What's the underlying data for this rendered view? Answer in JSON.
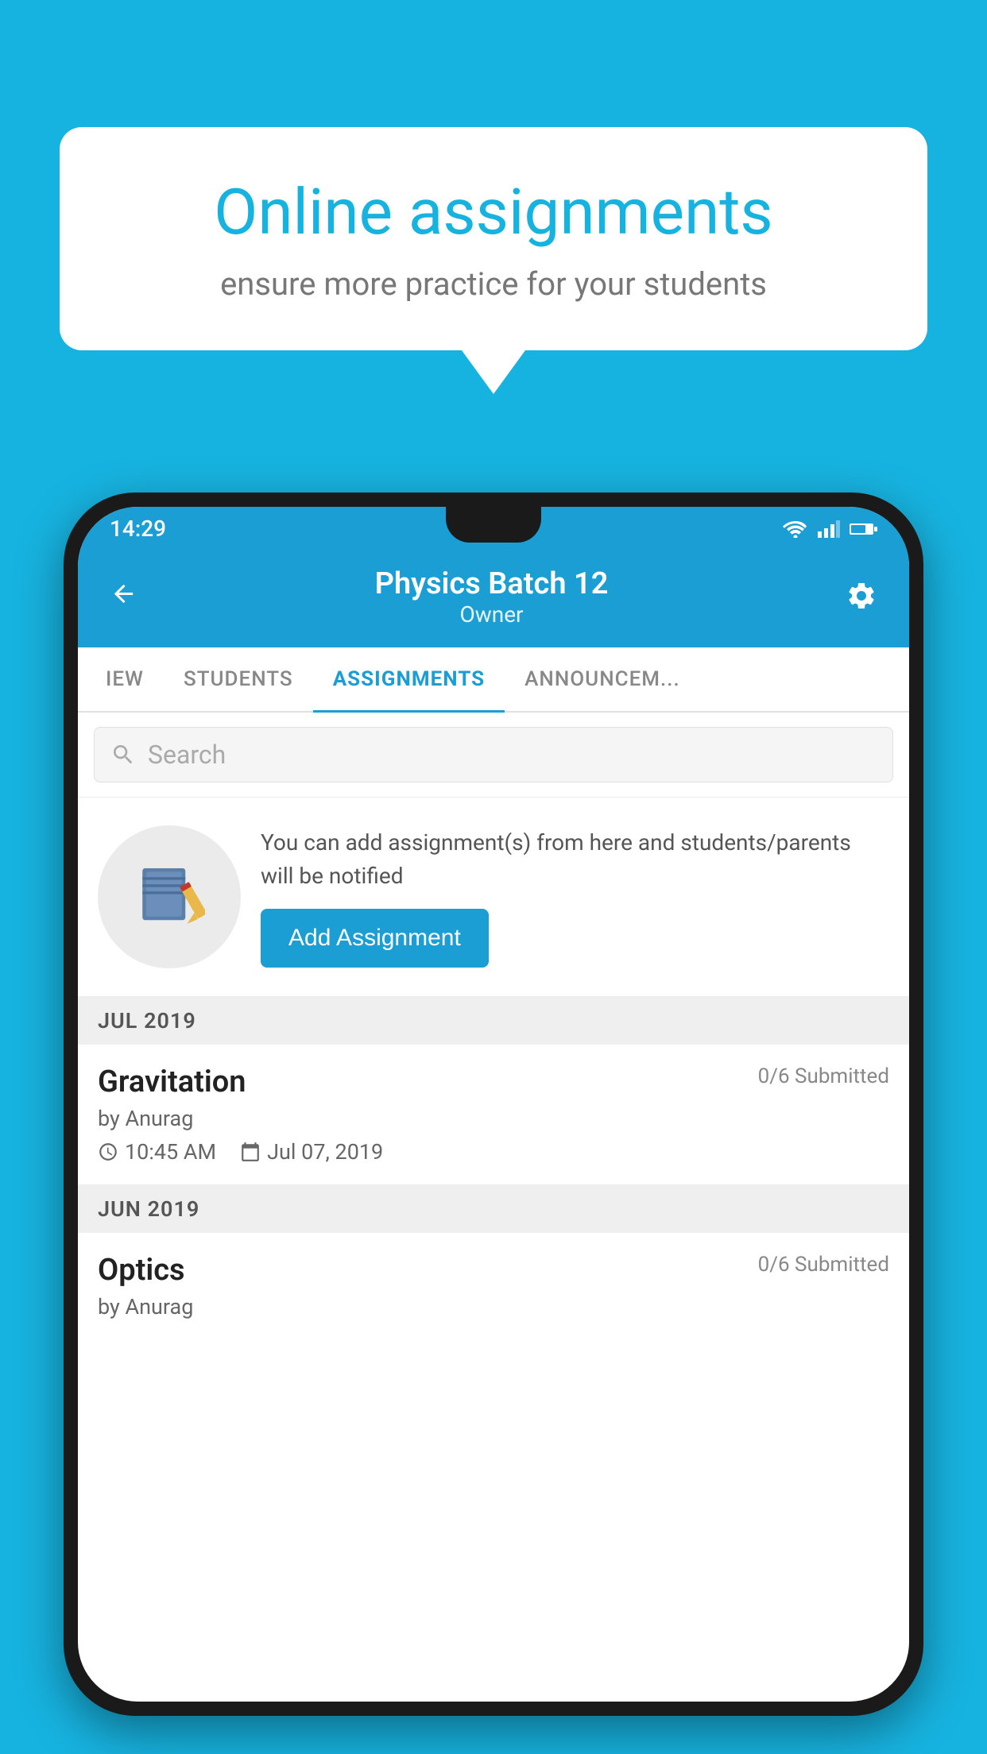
{
  "background_color": "#17b3e0",
  "speech_bubble": {
    "title": "Online assignments",
    "subtitle": "ensure more practice for your students"
  },
  "status_bar": {
    "time": "14:29"
  },
  "header": {
    "title": "Physics Batch 12",
    "subtitle": "Owner"
  },
  "tabs": [
    {
      "label": "IEW",
      "active": false
    },
    {
      "label": "STUDENTS",
      "active": false
    },
    {
      "label": "ASSIGNMENTS",
      "active": true
    },
    {
      "label": "ANNOUNCEM...",
      "active": false
    }
  ],
  "search": {
    "placeholder": "Search"
  },
  "promo": {
    "text": "You can add assignment(s) from here and students/parents will be notified",
    "button_label": "Add Assignment"
  },
  "sections": [
    {
      "month": "JUL 2019",
      "assignments": [
        {
          "title": "Gravitation",
          "submitted": "0/6 Submitted",
          "by": "by Anurag",
          "time": "10:45 AM",
          "date": "Jul 07, 2019"
        }
      ]
    },
    {
      "month": "JUN 2019",
      "assignments": [
        {
          "title": "Optics",
          "submitted": "0/6 Submitted",
          "by": "by Anurag",
          "time": "",
          "date": ""
        }
      ]
    }
  ]
}
